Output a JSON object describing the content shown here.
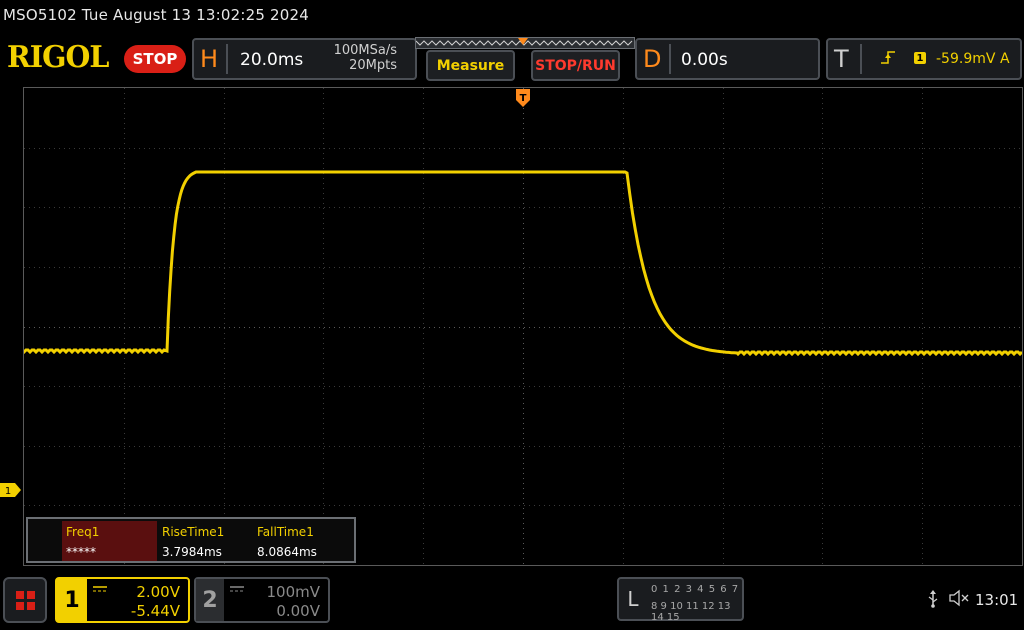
{
  "header": {
    "model_datetime": "MSO5102  Tue August 13 13:02:25 2024",
    "brand": "RIGOL",
    "run_state": "STOP"
  },
  "horizontal": {
    "letter": "H",
    "timebase": "20.0ms",
    "sample_rate": "100MSa/s",
    "memory_depth": "20Mpts"
  },
  "buttons": {
    "measure": "Measure",
    "stop_run": "STOP/RUN"
  },
  "delay": {
    "letter": "D",
    "value": "0.00s"
  },
  "trigger": {
    "letter": "T",
    "source": "1",
    "level": "-59.9mV",
    "mode": "A"
  },
  "measurements": {
    "items": [
      {
        "label": "Freq1",
        "value": "*****"
      },
      {
        "label": "RiseTime1",
        "value": "3.7984ms"
      },
      {
        "label": "FallTime1",
        "value": "8.0864ms"
      }
    ]
  },
  "channels": {
    "ch1": {
      "number": "1",
      "scale": "2.00V",
      "offset": "-5.44V",
      "color": "#f2d000"
    },
    "ch2": {
      "number": "2",
      "scale": "100mV",
      "offset": "0.00V",
      "color": "#8a8a8a"
    }
  },
  "logic_analyzer": {
    "letter": "L",
    "row1": "0 1 2 3  4 5 6 7",
    "row2": "8 9 10 11 12 13 14 15"
  },
  "status": {
    "time": "13:01",
    "icons": [
      "usb-icon",
      "speaker-muted-icon"
    ]
  },
  "markers": {
    "ch1_ground": "1"
  }
}
